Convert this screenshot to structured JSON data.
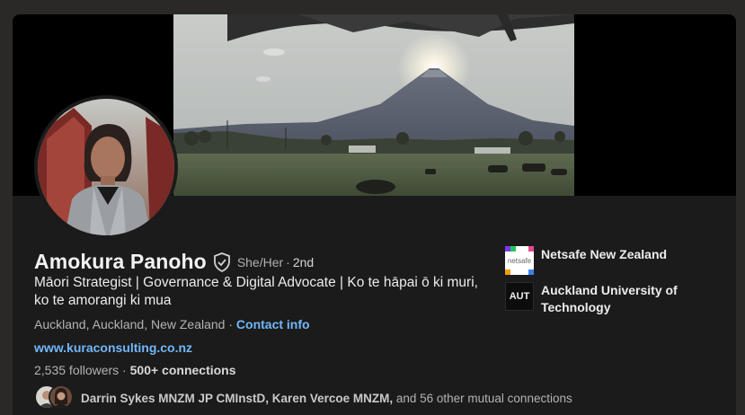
{
  "profile": {
    "name": "Amokura Panoho",
    "pronouns": "She/Her",
    "separator": "·",
    "degree": "2nd",
    "headline": "Māori Strategist | Governance & Digital Advocate | Ko te hāpai ō ki muri, ko te amorangi ki mua",
    "location": "Auckland, Auckland, New Zealand",
    "location_separator": " · ",
    "contact_info_label": "Contact info",
    "website": "www.kuraconsulting.co.nz",
    "followers": "2,535 followers",
    "stats_separator": " · ",
    "connections": "500+ connections",
    "mutual_names": "Darrin Sykes MNZM JP CMInstD, Karen Vercoe MNZM,",
    "mutual_rest": " and 56 other mutual connections"
  },
  "companies": [
    {
      "name": "Netsafe New Zealand",
      "logo_text": "netsafe",
      "icon": "netsafe-logo"
    },
    {
      "name": "Auckland University of Technology",
      "logo_text": "AUT",
      "icon": "aut-logo"
    }
  ],
  "colors": {
    "page_bg": "#2a2927",
    "card_bg": "#1b1b1b",
    "link": "#71b7fb",
    "text_primary": "#ececec",
    "text_secondary": "#b3b3b3"
  }
}
